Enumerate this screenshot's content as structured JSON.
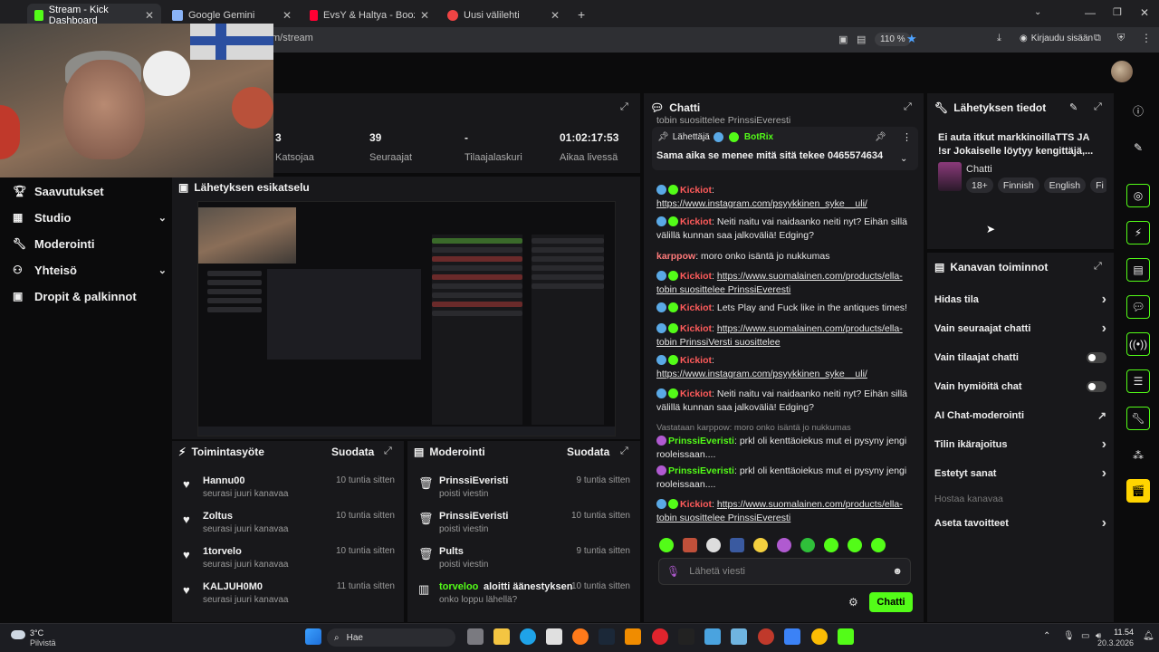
{
  "tabs": [
    {
      "label": "Stream - Kick Dashboard",
      "color": "#53fc18"
    },
    {
      "label": "Google Gemini",
      "color": "#8ab4f8"
    },
    {
      "label": "EvsY & Haltya - Boozy's Fu",
      "color": "#ff0033"
    },
    {
      "label": "Uusi välilehti",
      "color": "#e44"
    }
  ],
  "address": {
    "url": "m/stream",
    "zoom": "110 %",
    "login": "Kirjaudu sisään"
  },
  "nav": [
    {
      "label": "Saavutukset",
      "icon": "trophy-icon",
      "chev": false
    },
    {
      "label": "Studio",
      "icon": "studio-icon",
      "chev": true
    },
    {
      "label": "Moderointi",
      "icon": "wrench-icon",
      "chev": false
    },
    {
      "label": "Yhteisö",
      "icon": "community-icon",
      "chev": true
    },
    {
      "label": "Dropit & palkinnot",
      "icon": "gift-icon",
      "chev": false
    }
  ],
  "stats": [
    {
      "value": "3",
      "label": "Katsojaa"
    },
    {
      "value": "39",
      "label": "Seuraajat"
    },
    {
      "value": "-",
      "label": "Tilaajalaskuri"
    },
    {
      "value": "01:02:17:53",
      "label": "Aikaa livessä"
    }
  ],
  "preview": {
    "title": "Lähetyksen esikatselu"
  },
  "activity": {
    "title": "Toimintasyöte",
    "filter": "Suodata",
    "items": [
      {
        "name": "Hannu00",
        "sub": "seurasi juuri kanavaa",
        "time": "10 tuntia sitten"
      },
      {
        "name": "Zoltus",
        "sub": "seurasi juuri kanavaa",
        "time": "10 tuntia sitten"
      },
      {
        "name": "1torvelo",
        "sub": "seurasi juuri kanavaa",
        "time": "10 tuntia sitten"
      },
      {
        "name": "KALJUH0M0",
        "sub": "seurasi juuri kanavaa",
        "time": "11 tuntia sitten"
      }
    ]
  },
  "moderation": {
    "title": "Moderointi",
    "filter": "Suodata",
    "items": [
      {
        "name": "PrinssiEveristi",
        "sub": "poisti viestin",
        "time": "9 tuntia sitten"
      },
      {
        "name": "PrinssiEveristi",
        "sub": "poisti viestin",
        "time": "10 tuntia sitten"
      },
      {
        "name": "Pults",
        "sub": "poisti viestin",
        "time": "9 tuntia sitten"
      },
      {
        "name": "torveloo",
        "action": "aloitti äänestyksen",
        "sub": "onko loppu lähellä?",
        "time": "10 tuntia sitten"
      }
    ]
  },
  "chat": {
    "title": "Chatti",
    "top_text": "tobin suosittelee PrinssiEveresti",
    "pinned": {
      "label": "Lähettäjä",
      "user": "BotRix",
      "text": "Sama aika se menee mitä sitä tekee 0465574634"
    },
    "messages": [
      {
        "user": "Kickiot",
        "text": "https://www.instagram.com/psyykkinen_syke__uli/"
      },
      {
        "user": "Kickiot",
        "text": "Neiti naitu vai naidaanko neiti nyt? Eihän sillä välillä kunnan saa jalkoväliä! Edging?"
      },
      {
        "user": "karppow",
        "text": "moro onko isäntä jo nukkumas"
      },
      {
        "user": "Kickiot",
        "text": "https://www.suomalainen.com/products/ella-tobin suosittelee PrinssiEveresti"
      },
      {
        "user": "Kickiot",
        "text": "Lets Play and Fuck like in the antiques times!"
      },
      {
        "user": "Kickiot",
        "text": "https://www.suomalainen.com/products/ella-tobin PrinssiVersti suosittelee"
      },
      {
        "user": "Kickiot",
        "text": "https://www.instagram.com/psyykkinen_syke__uli/"
      },
      {
        "user": "Kickiot",
        "text": "Neiti naitu vai naidaanko neiti nyt? Eihän sillä välillä kunnan saa jalkoväliä! Edging?"
      },
      {
        "reply": "Vastataan karppow: moro onko isäntä jo nukkumas",
        "user": "PrinssiEveristi",
        "text": "prkl oli kenttäoiekus mut ei pysyny jengi rooleissaan...."
      },
      {
        "user": "PrinssiEveristi",
        "text": "prkl oli kenttäoiekus mut ei pysyny jengi rooleissaan...."
      },
      {
        "user": "Kickiot",
        "text": "https://www.suomalainen.com/products/ella-tobin suosittelee PrinssiEveresti"
      }
    ],
    "input_placeholder": "Lähetä viesti",
    "send": "Chatti"
  },
  "stream_info": {
    "title": "Lähetyksen tiedot",
    "text": "Ei auta itkut markkinoillaTTS JA !sr Jokaiselle löytyy kengittäjä,...",
    "category": "Chatti",
    "tags": [
      "18+",
      "Finnish",
      "English",
      "Fi"
    ]
  },
  "channel_actions": {
    "title": "Kanavan toiminnot",
    "items": [
      {
        "label": "Hidas tila",
        "kind": "chevron"
      },
      {
        "label": "Vain seuraajat chatti",
        "kind": "chevron"
      },
      {
        "label": "Vain tilaajat chatti",
        "kind": "toggle"
      },
      {
        "label": "Vain hymiöitä chat",
        "kind": "toggle"
      },
      {
        "label": "AI Chat-moderointi",
        "kind": "external"
      },
      {
        "label": "Tilin ikärajoitus",
        "kind": "chevron"
      },
      {
        "label": "Estetyt sanat",
        "kind": "chevron"
      },
      {
        "label": "Hostaa kanavaa",
        "kind": "disabled"
      },
      {
        "label": "Aseta tavoitteet",
        "kind": "chevron"
      }
    ]
  },
  "taskbar": {
    "weather_temp": "3°C",
    "weather_desc": "Pilvistä",
    "search": "Hae",
    "time": "11.54",
    "date": "20.3.2026"
  }
}
